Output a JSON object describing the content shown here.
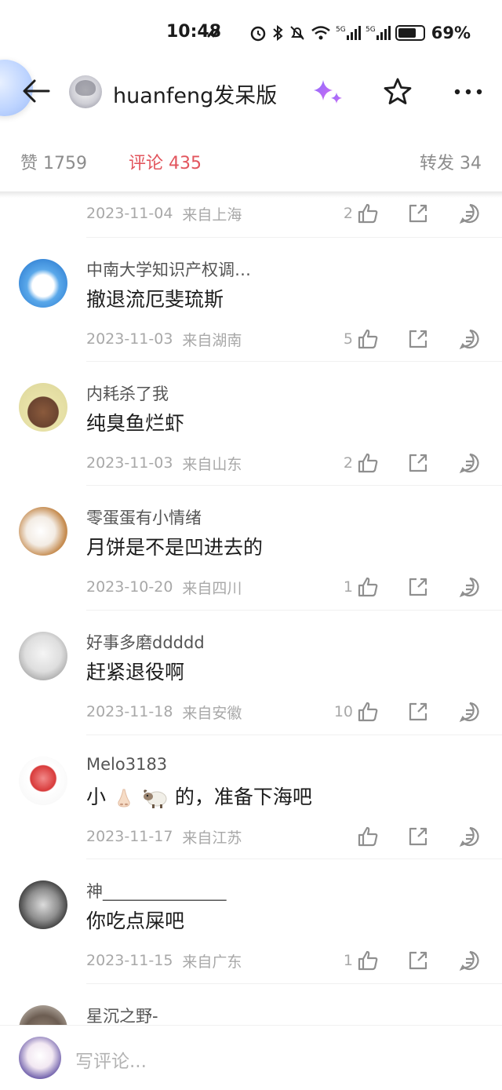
{
  "status_bar": {
    "time": "10:48",
    "battery": "69%",
    "network_label": "5G"
  },
  "header": {
    "title": "huanfeng发呆版",
    "icons": [
      "back-arrow-icon",
      "sparkle-icon",
      "star-icon",
      "more-icon"
    ]
  },
  "tabs": {
    "likes": "赞 1759",
    "comments": "评论 435",
    "reposts": "转发 34",
    "active": "comments",
    "active_color": "#e2555d"
  },
  "partial_top": {
    "date": "2023-11-04",
    "location": "来自上海",
    "likes": "2"
  },
  "comments": [
    {
      "user": "中南大学知识产权调…",
      "text": "撤退流厄斐琉斯",
      "date": "2023-11-03",
      "location": "来自湖南",
      "likes": "5"
    },
    {
      "user": "内耗杀了我",
      "text": "纯臭鱼烂虾",
      "date": "2023-11-03",
      "location": "来自山东",
      "likes": "2"
    },
    {
      "user": "零蛋蛋有小情绪",
      "text": "月饼是不是凹进去的",
      "date": "2023-10-20",
      "location": "来自四川",
      "likes": "1"
    },
    {
      "user": "好事多磨ddddd",
      "text": "赶紧退役啊",
      "date": "2023-11-18",
      "location": "来自安徽",
      "likes": "10"
    },
    {
      "user": "Melo3183",
      "text_prefix": "小",
      "text_suffix": "的，准备下海吧",
      "emojis": [
        "nose-emoji",
        "sheep-emoji"
      ],
      "date": "2023-11-17",
      "location": "来自江苏",
      "likes": ""
    },
    {
      "user": "神_______________",
      "text": "你吃点屎吧",
      "date": "2023-11-15",
      "location": "来自广东",
      "likes": "1"
    },
    {
      "user": "星沉之野-"
    }
  ],
  "bottom_bar": {
    "placeholder": "写评论..."
  }
}
